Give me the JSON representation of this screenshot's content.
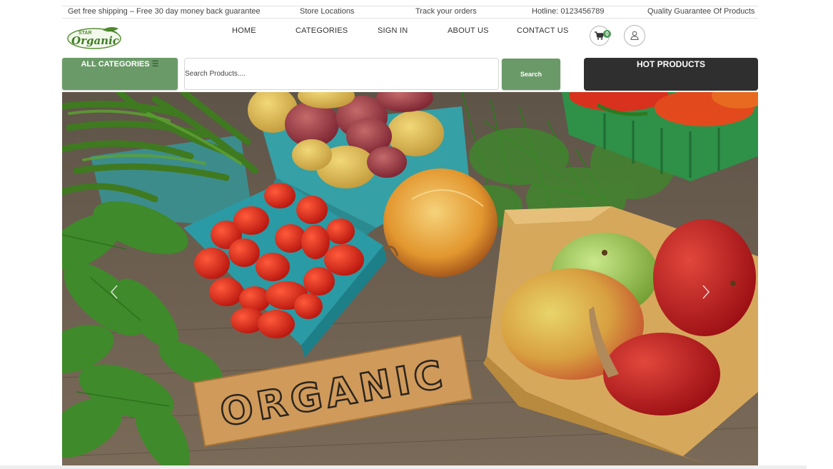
{
  "topbar": {
    "shipping": "Get free shipping – Free 30 day money back guarantee",
    "stores": "Store Locations",
    "track": "Track your orders",
    "hotline": "Hotline: 0123456789",
    "quality": "Quality Guarantee Of Products"
  },
  "logo": {
    "text_top": "STAR",
    "text_main": "Organic"
  },
  "nav": {
    "home": "HOME",
    "categories": "CATEGORIES",
    "sign_in": "SIGN IN",
    "about": "ABOUT US",
    "contact": "CONTACT US"
  },
  "cart": {
    "count": "0"
  },
  "toolbar": {
    "all_categories": "ALL CATEGORIES",
    "all_categories_icon": "☰",
    "search_placeholder": "Search Products....",
    "search_button": "Search",
    "hot_products": "HOT PRODUCTS"
  },
  "hero": {
    "sign_text": "ORGANIC"
  },
  "colors": {
    "accent_green": "#6b9a69",
    "dark_button": "#2f2f2f",
    "badge_green": "#4f9a5a"
  },
  "icons": {
    "cart": "cart-icon",
    "user": "user-icon",
    "prev": "chevron-left-icon",
    "next": "chevron-right-icon",
    "menu": "hamburger-icon"
  }
}
